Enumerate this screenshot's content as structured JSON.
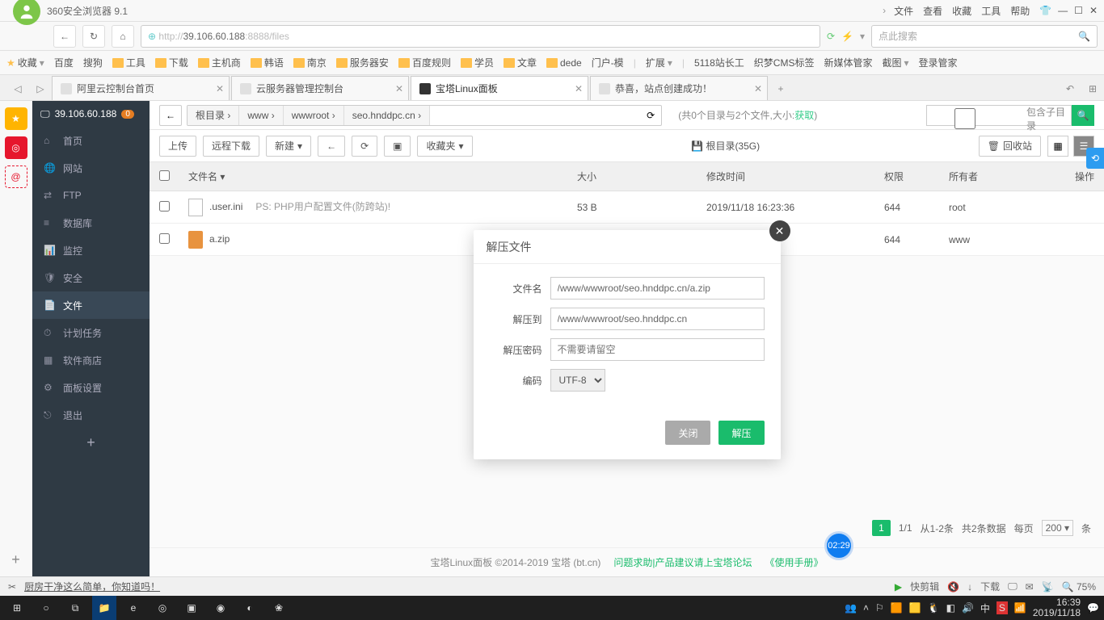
{
  "browser": {
    "title": "360安全浏览器 9.1",
    "menu": [
      "文件",
      "查看",
      "收藏",
      "工具",
      "帮助"
    ],
    "url_prefix": "http://",
    "url_host": "39.106.60.188",
    "url_port": ":8888",
    "url_path": "/files",
    "search_placeholder": "点此搜索"
  },
  "bookmarks": [
    "收藏",
    "百度",
    "搜狗",
    "工具",
    "下载",
    "主机商",
    "韩语",
    "南京",
    "服务器安",
    "百度规则",
    "学员",
    "文章",
    "dede",
    "门户-模",
    "扩展",
    "5118站长工",
    "织梦CMS标签",
    "新媒体管家",
    "截图",
    "登录管家"
  ],
  "tabs": [
    {
      "label": "阿里云控制台首页",
      "active": false
    },
    {
      "label": "云服务器管理控制台",
      "active": false
    },
    {
      "label": "宝塔Linux面板",
      "active": true
    },
    {
      "label": "恭喜，站点创建成功！",
      "active": false
    }
  ],
  "sidebar": {
    "ip": "39.106.60.188",
    "badge": "0",
    "items": [
      {
        "label": "首页"
      },
      {
        "label": "网站"
      },
      {
        "label": "FTP"
      },
      {
        "label": "数据库"
      },
      {
        "label": "监控"
      },
      {
        "label": "安全"
      },
      {
        "label": "文件"
      },
      {
        "label": "计划任务"
      },
      {
        "label": "软件商店"
      },
      {
        "label": "面板设置"
      },
      {
        "label": "退出"
      }
    ]
  },
  "path": {
    "crumbs": [
      "根目录",
      "www",
      "wwwroot",
      "seo.hnddpc.cn"
    ],
    "info": "(共0个目录与2个文件,大小:",
    "info_link": "获取",
    "info_end": ")",
    "search_placeholder": "",
    "sub_label": "包含子目录"
  },
  "toolbar": {
    "upload": "上传",
    "remote": "远程下载",
    "new": "新建",
    "fav": "收藏夹",
    "disk": "根目录(35G)",
    "recycle": "回收站"
  },
  "table": {
    "cols": {
      "name": "文件名",
      "size": "大小",
      "time": "修改时间",
      "perm": "权限",
      "owner": "所有者",
      "op": "操作"
    },
    "rows": [
      {
        "name": ".user.ini",
        "desc": "PS: PHP用户配置文件(防跨站)!",
        "size": "53 B",
        "time": "2019/11/18 16:23:36",
        "perm": "644",
        "owner": "root",
        "type": "txt"
      },
      {
        "name": "a.zip",
        "desc": "",
        "size": "",
        "time": "",
        "perm": "644",
        "owner": "www",
        "type": "zip"
      }
    ]
  },
  "modal": {
    "title": "解压文件",
    "label_file": "文件名",
    "label_dest": "解压到",
    "label_pass": "解压密码",
    "label_enc": "编码",
    "file_value": "/www/wwwroot/seo.hnddpc.cn/a.zip",
    "dest_value": "/www/wwwroot/seo.hnddpc.cn",
    "pass_placeholder": "不需要请留空",
    "enc_value": "UTF-8",
    "btn_close": "关闭",
    "btn_ok": "解压"
  },
  "pager": {
    "cur": "1",
    "total": "1/1",
    "range": "从1-2条",
    "count": "共2条数据",
    "per_label": "每页",
    "per": "200",
    "unit": "条"
  },
  "footer": {
    "copy": "宝塔Linux面板 ©2014-2019 宝塔 (bt.cn)",
    "link1": "问题求助|产品建议请上宝塔论坛",
    "link2": "《使用手册》"
  },
  "status": {
    "hot": "厨房干净这么简单，你知道吗！",
    "cut": "快剪辑",
    "dl": "下载",
    "zoom": "75%"
  },
  "bubble": "02:29",
  "clock": {
    "time": "16:39",
    "date": "2019/11/18"
  }
}
